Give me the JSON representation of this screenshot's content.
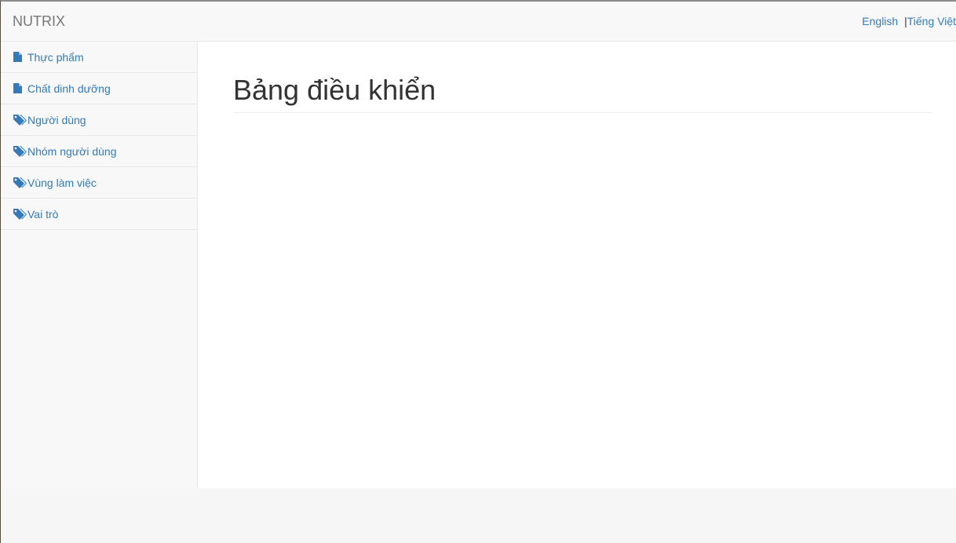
{
  "navbar": {
    "brand": "NUTRIX",
    "languages": [
      {
        "label": "English"
      },
      {
        "label": "Tiếng Việt"
      }
    ],
    "separator": "|"
  },
  "sidebar": {
    "items": [
      {
        "label": "Thực phẩm",
        "icon": "file-icon"
      },
      {
        "label": "Chất dinh dưỡng",
        "icon": "file-icon"
      },
      {
        "label": "Người dùng",
        "icon": "tags-icon"
      },
      {
        "label": "Nhóm người dùng",
        "icon": "tags-icon"
      },
      {
        "label": "Vùng làm việc",
        "icon": "tags-icon"
      },
      {
        "label": "Vai trò",
        "icon": "tags-icon"
      }
    ]
  },
  "main": {
    "title": "Bảng điều khiển"
  },
  "colors": {
    "link": "#337ab7",
    "brand": "#777777",
    "navbar_bg": "#f8f8f8",
    "border": "#e7e7e7"
  }
}
